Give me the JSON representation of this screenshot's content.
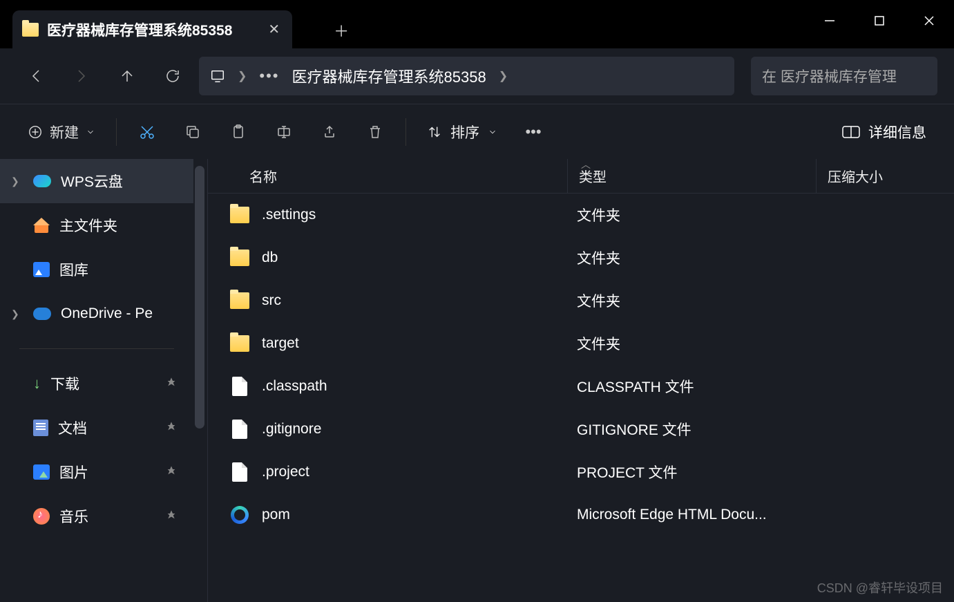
{
  "tab": {
    "title": "医疗器械库存管理系统85358"
  },
  "address": {
    "folder": "医疗器械库存管理系统85358"
  },
  "search": {
    "placeholder": "在 医疗器械库存管理"
  },
  "toolbar": {
    "new_label": "新建",
    "sort_label": "排序",
    "details_label": "详细信息"
  },
  "sidebar": {
    "items": [
      {
        "label": "WPS云盘",
        "icon": "cloud",
        "expandable": true,
        "selected": true
      },
      {
        "label": "主文件夹",
        "icon": "home"
      },
      {
        "label": "图库",
        "icon": "gallery"
      },
      {
        "label": "OneDrive - Pe",
        "icon": "onedrive",
        "expandable": true
      }
    ],
    "quick": [
      {
        "label": "下载",
        "icon": "download",
        "pinned": true
      },
      {
        "label": "文档",
        "icon": "doc",
        "pinned": true
      },
      {
        "label": "图片",
        "icon": "pic",
        "pinned": true
      },
      {
        "label": "音乐",
        "icon": "music",
        "pinned": true
      }
    ]
  },
  "columns": {
    "name": "名称",
    "type": "类型",
    "size": "压缩大小"
  },
  "files": [
    {
      "name": ".settings",
      "type": "文件夹",
      "icon": "folder"
    },
    {
      "name": "db",
      "type": "文件夹",
      "icon": "folder"
    },
    {
      "name": "src",
      "type": "文件夹",
      "icon": "folder"
    },
    {
      "name": "target",
      "type": "文件夹",
      "icon": "folder"
    },
    {
      "name": ".classpath",
      "type": "CLASSPATH 文件",
      "icon": "file"
    },
    {
      "name": ".gitignore",
      "type": "GITIGNORE 文件",
      "icon": "file"
    },
    {
      "name": ".project",
      "type": "PROJECT 文件",
      "icon": "file"
    },
    {
      "name": "pom",
      "type": "Microsoft Edge HTML Docu...",
      "icon": "edge"
    }
  ],
  "watermark": "CSDN @睿轩毕设项目"
}
